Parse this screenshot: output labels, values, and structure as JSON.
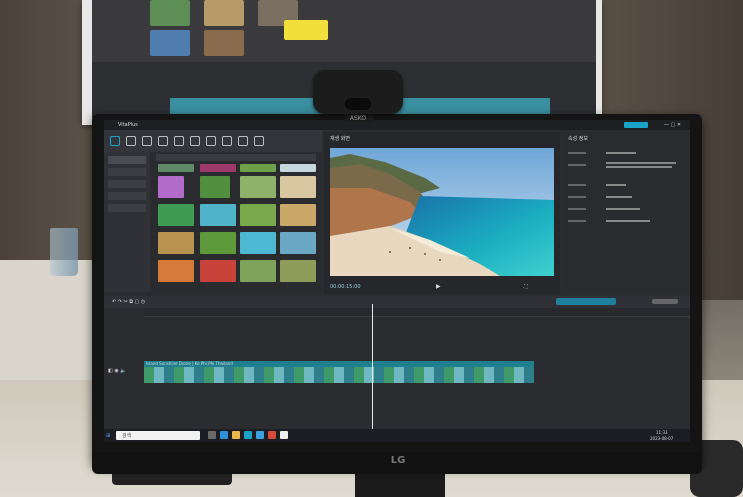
{
  "webcam": {
    "brand": "ASKO"
  },
  "monitor": {
    "brand": "LG"
  },
  "editor": {
    "app_name": "VitaPlus",
    "preview_label": "재생 화면",
    "props_header": "속성 정보",
    "timeline_clip_text": "Island Sunshine Drone | Ko Phi Phi Thailand",
    "timecode": "00:00:15:00"
  },
  "taskbar": {
    "search_placeholder": "검색",
    "time": "11:33",
    "date": "2023-08-07"
  },
  "colors": {
    "accent_teal": "#1f7f8c",
    "sticky_note": "#f3df3c",
    "screen_bg": "#2b2c30"
  }
}
